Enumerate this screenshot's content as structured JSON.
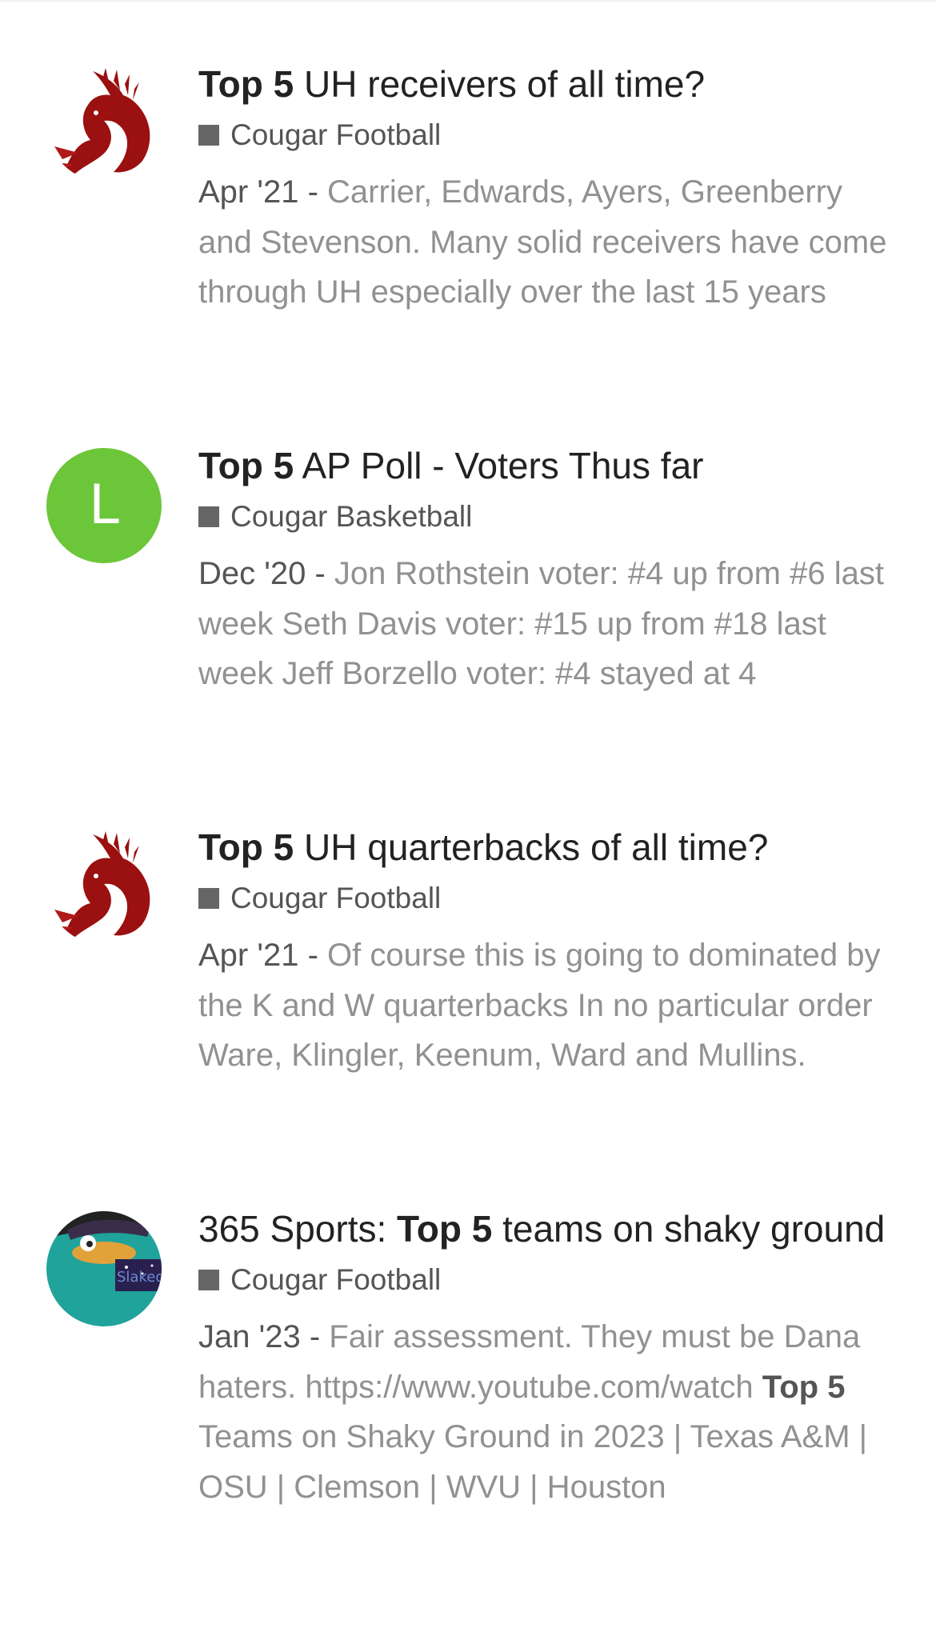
{
  "results": [
    {
      "title_highlight": "Top 5",
      "title_rest": " UH receivers of all time?",
      "category": "Cougar Football",
      "date": "Apr '21",
      "separator": " - ",
      "blurb": "Carrier, Edwards, Ayers, Greenberry and Stevenson. Many solid receivers have come through UH especially over the last 15 years",
      "avatar_icon": "red-dragon-icon"
    },
    {
      "title_highlight": "Top 5",
      "title_rest": " AP Poll - Voters Thus far",
      "category": "Cougar Basketball",
      "date": "Dec '20",
      "separator": " - ",
      "blurb": "Jon Rothstein voter: #4 up from #6 last week Seth Davis voter: #15 up from #18 last week Jeff Borzello voter: #4 stayed at 4",
      "avatar_letter": "L",
      "avatar_color": "#6cc63a"
    },
    {
      "title_highlight": "Top 5",
      "title_rest": " UH quarterbacks of all time?",
      "category": "Cougar Football",
      "date": "Apr '21",
      "separator": " - ",
      "blurb": "Of course this is going to dominated by the K and W quarterbacks In no particular order Ware, Klingler, Keenum, Ward and Mullins.",
      "avatar_icon": "red-dragon-icon"
    },
    {
      "title_prefix": "365 Sports: ",
      "title_highlight": "Top 5",
      "title_rest": " teams on shaky ground",
      "category": "Cougar Football",
      "date": "Jan '23",
      "separator": " - ",
      "blurb_before": "Fair assessment. They must be Dana haters. https://www.youtube.com/watch ",
      "blurb_highlight": "Top 5",
      "blurb_after": " Teams on Shaky Ground in 2023 | Texas A&M | OSU | Clemson | WVU | Houston",
      "avatar_icon": "perry-platypus-icon",
      "avatar_text": "Slaked"
    }
  ],
  "colors": {
    "category_square": "#666666",
    "blurb_text": "#919191",
    "date_text": "#555555",
    "title_text": "#222222",
    "avatar_green": "#6cc63a",
    "dragon_red": "#9b1010",
    "perry_teal": "#1fa39a"
  }
}
